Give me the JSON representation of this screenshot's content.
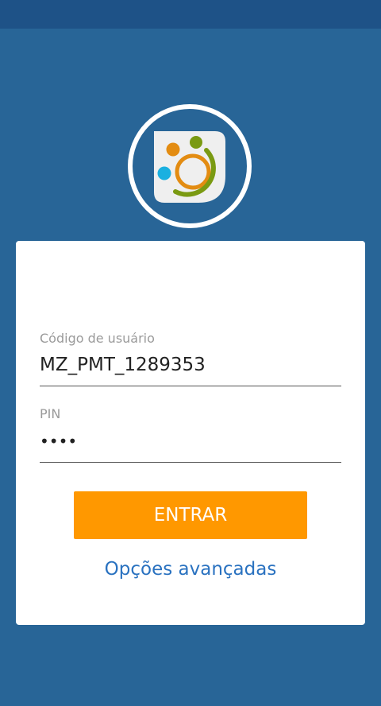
{
  "colors": {
    "background": "#286597",
    "status_bar": "#1e5287",
    "button": "#ff9800",
    "link": "#2a72c0"
  },
  "logo": {
    "icon": "app-logo-icon"
  },
  "form": {
    "user_code": {
      "label": "Código de usuário",
      "value": "MZ_PMT_1289353"
    },
    "pin": {
      "label": "PIN",
      "value": "••••"
    },
    "submit_label": "ENTRAR",
    "advanced_options_label": "Opções avançadas"
  }
}
